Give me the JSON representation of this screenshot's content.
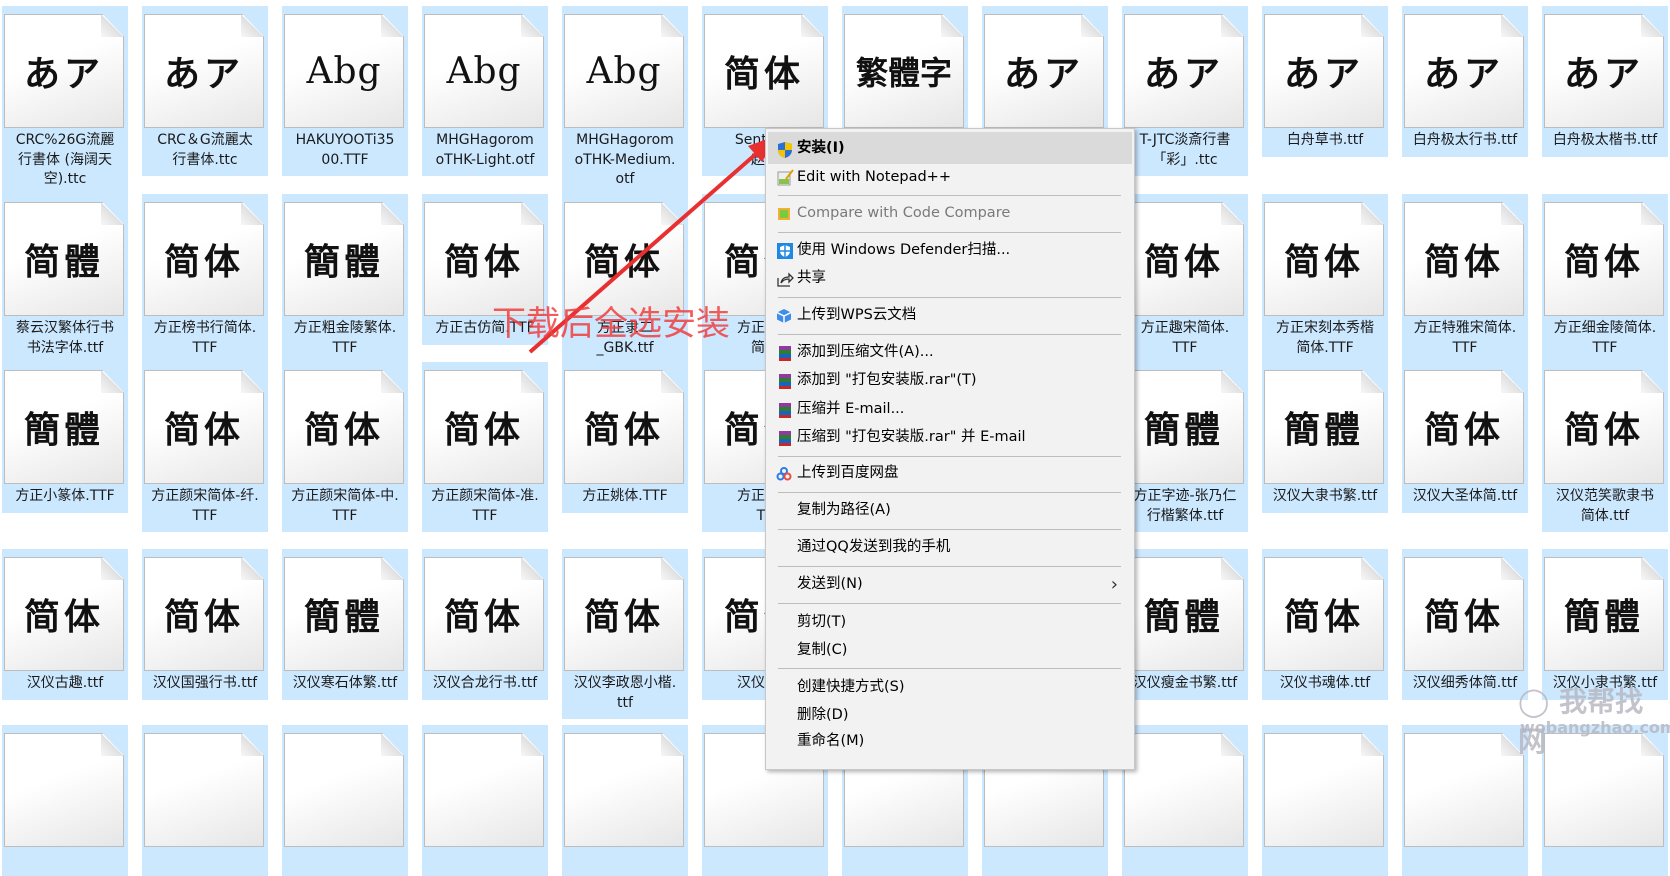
{
  "files": {
    "rows": [
      [
        {
          "glyph": "あア",
          "name": "CRC%26G流麗\n行書体 (海阔天\n空).ttc"
        },
        {
          "glyph": "あア",
          "name": "CRC＆G流麗太\n行書体.ttc"
        },
        {
          "glyph": "Abg",
          "name": "HAKUYOOTi35\n00.TTF"
        },
        {
          "glyph": "Abg",
          "name": "MHGHagorom\noTHK-Light.otf"
        },
        {
          "glyph": "Abg",
          "name": "MHGHagorom\noTHK-Medium.\notf"
        },
        {
          "glyph": "简体",
          "name": "SentyZH\n赵孟"
        },
        {
          "glyph": "繁體字",
          "name": ""
        },
        {
          "glyph": "あア",
          "name": ""
        },
        {
          "glyph": "あア",
          "name": "T-JTC淡斎行書\n「彩」.ttc"
        },
        {
          "glyph": "あア",
          "name": "白舟草书.ttf"
        },
        {
          "glyph": "あア",
          "name": "白舟极太行书.ttf"
        },
        {
          "glyph": "あア",
          "name": "白舟极太楷书.ttf"
        }
      ],
      [
        {
          "glyph": "简體",
          "name": "蔡云汉繁体行书\n书法字体.ttf"
        },
        {
          "glyph": "简体",
          "name": "方正榜书行简体.\nTTF"
        },
        {
          "glyph": "簡體",
          "name": "方正粗金陵繁体.\nTTF"
        },
        {
          "glyph": "简体",
          "name": "方正古仿简.TTF"
        },
        {
          "glyph": "简体",
          "name": "方正隶二\n_GBK.ttf"
        },
        {
          "glyph": "简体",
          "name": "方正吕建\n简体"
        },
        {
          "glyph": "",
          "name": ""
        },
        {
          "glyph": "",
          "name": ""
        },
        {
          "glyph": "简体",
          "name": "方正趣宋简体.\nTTF"
        },
        {
          "glyph": "简体",
          "name": "方正宋刻本秀楷\n简体.TTF"
        },
        {
          "glyph": "简体",
          "name": "方正特雅宋简体.\nTTF"
        },
        {
          "glyph": "简体",
          "name": "方正细金陵简体.\nTTF"
        }
      ],
      [
        {
          "glyph": "簡體",
          "name": "方正小篆体.TTF"
        },
        {
          "glyph": "简体",
          "name": "方正颜宋简体-纤.\nTTF"
        },
        {
          "glyph": "简体",
          "name": "方正颜宋简体-中.\nTTF"
        },
        {
          "glyph": "简体",
          "name": "方正颜宋简体-准.\nTTF"
        },
        {
          "glyph": "简体",
          "name": "方正姚体.TTF"
        },
        {
          "glyph": "简体",
          "name": "方正萤雪\nTT"
        },
        {
          "glyph": "",
          "name": ""
        },
        {
          "glyph": "",
          "name": ""
        },
        {
          "glyph": "簡體",
          "name": "方正字迹-张乃仁\n行楷繁体.ttf"
        },
        {
          "glyph": "簡體",
          "name": "汉仪大隶书繁.ttf"
        },
        {
          "glyph": "简体",
          "name": "汉仪大圣体简.ttf"
        },
        {
          "glyph": "简体",
          "name": "汉仪范笑歌隶书\n简体.ttf"
        }
      ],
      [
        {
          "glyph": "简体",
          "name": "汉仪古趣.ttf"
        },
        {
          "glyph": "简体",
          "name": "汉仪国强行书.ttf"
        },
        {
          "glyph": "簡體",
          "name": "汉仪寒石体繁.ttf"
        },
        {
          "glyph": "简体",
          "name": "汉仪合龙行书.ttf"
        },
        {
          "glyph": "简体",
          "name": "汉仪李政恩小楷.\nttf"
        },
        {
          "glyph": "简体",
          "name": "汉仪南宫"
        },
        {
          "glyph": "",
          "name": ""
        },
        {
          "glyph": "",
          "name": ""
        },
        {
          "glyph": "簡體",
          "name": "汉仪瘦金书繁.ttf"
        },
        {
          "glyph": "简体",
          "name": "汉仪书魂体.ttf"
        },
        {
          "glyph": "简体",
          "name": "汉仪细秀体简.ttf"
        },
        {
          "glyph": "簡體",
          "name": "汉仪小隶书繁.ttf"
        }
      ],
      [
        {
          "glyph": "",
          "name": ""
        },
        {
          "glyph": "",
          "name": ""
        },
        {
          "glyph": "",
          "name": ""
        },
        {
          "glyph": "",
          "name": ""
        },
        {
          "glyph": "",
          "name": ""
        },
        {
          "glyph": "",
          "name": ""
        },
        {
          "glyph": "",
          "name": ""
        },
        {
          "glyph": "",
          "name": ""
        },
        {
          "glyph": "",
          "name": ""
        },
        {
          "glyph": "",
          "name": ""
        },
        {
          "glyph": "",
          "name": ""
        },
        {
          "glyph": "",
          "name": ""
        }
      ]
    ]
  },
  "context_menu": {
    "items": [
      {
        "label": "安装(I)",
        "icon": "shield-uac-icon",
        "bold": true,
        "highlighted": true
      },
      {
        "label": "Edit with Notepad++",
        "icon": "notepad-plus-plus-icon"
      },
      {
        "label": "Compare with Code Compare",
        "icon": "code-compare-icon",
        "disabled": true
      },
      {
        "label": "使用 Windows Defender扫描...",
        "icon": "windows-defender-icon"
      },
      {
        "label": "共享",
        "icon": "share-icon"
      },
      {
        "label": "上传到WPS云文档",
        "icon": "wps-cloud-icon"
      },
      {
        "label": "添加到压缩文件(A)...",
        "icon": "winrar-icon"
      },
      {
        "label": "添加到 \"打包安装版.rar\"(T)",
        "icon": "winrar-icon"
      },
      {
        "label": "压缩并 E-mail...",
        "icon": "winrar-icon"
      },
      {
        "label": "压缩到 \"打包安装版.rar\" 并 E-mail",
        "icon": "winrar-icon"
      },
      {
        "label": "上传到百度网盘",
        "icon": "baidu-netdisk-icon"
      },
      {
        "label": "复制为路径(A)",
        "icon": ""
      },
      {
        "label": "通过QQ发送到我的手机",
        "icon": ""
      },
      {
        "label": "发送到(N)",
        "icon": "",
        "submenu": true
      },
      {
        "label": "剪切(T)",
        "icon": ""
      },
      {
        "label": "复制(C)",
        "icon": ""
      },
      {
        "label": "创建快捷方式(S)",
        "icon": ""
      },
      {
        "label": "删除(D)",
        "icon": ""
      },
      {
        "label": "重命名(M)",
        "icon": ""
      }
    ]
  },
  "annotation": {
    "text": "下载后全选安装",
    "color": "#f04040"
  },
  "watermark": {
    "text": "我帮找网",
    "url_text": "wobangzhao.com"
  },
  "colors": {
    "selection": "#cce8ff",
    "menu_bg": "#f2f2f2",
    "menu_highlight": "#dadada"
  }
}
